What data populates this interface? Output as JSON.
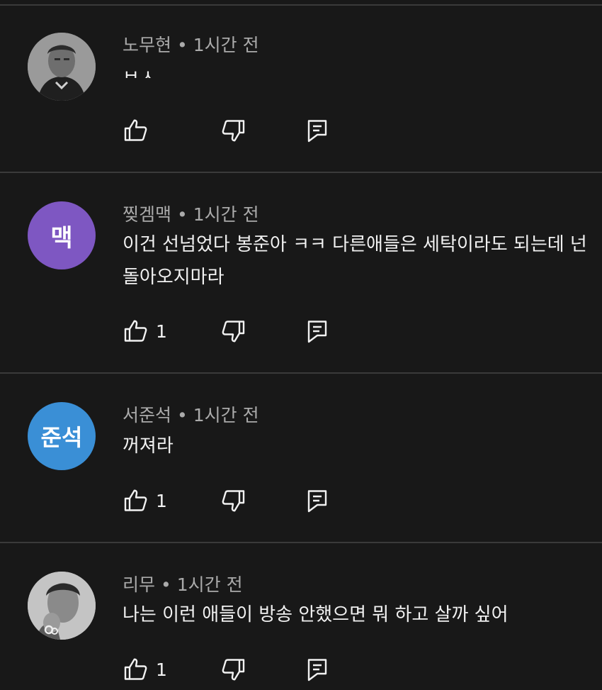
{
  "comments": [
    {
      "author": "노무현",
      "time": "1시간 전",
      "separator": "•",
      "text_lines": [
        "ㅂㅅ"
      ],
      "likes": "",
      "avatar": {
        "type": "photo",
        "bg": "#8c8c8c"
      }
    },
    {
      "author": "찢겜맥",
      "time": "1시간 전",
      "separator": "•",
      "text_lines": [
        "이건 선넘었다 봉준아 ㅋㅋ 다른애들은 세탁이라도 되는데 넌",
        "돌아오지마라"
      ],
      "likes": "1",
      "avatar": {
        "type": "initials",
        "label": "맥",
        "bg": "#7e57c2"
      }
    },
    {
      "author": "서준석",
      "time": "1시간 전",
      "separator": "•",
      "text_lines": [
        "꺼져라"
      ],
      "likes": "1",
      "avatar": {
        "type": "initials",
        "label": "준석",
        "bg": "#3a8fd6"
      }
    },
    {
      "author": "리무",
      "time": "1시간 전",
      "separator": "•",
      "text_lines": [
        "나는 이런 애들이 방송 안했으면 뭐 하고 살까 싶어"
      ],
      "likes": "1",
      "avatar": {
        "type": "photo",
        "bg": "#b8b8b8"
      }
    }
  ],
  "icons": {
    "like": "thumbs-up-icon",
    "dislike": "thumbs-down-icon",
    "reply": "reply-comment-icon"
  },
  "colors": {
    "background": "#181818",
    "divider": "#3a3a3a",
    "meta_text": "#aaaaaa",
    "body_text": "#f1f1f1"
  }
}
